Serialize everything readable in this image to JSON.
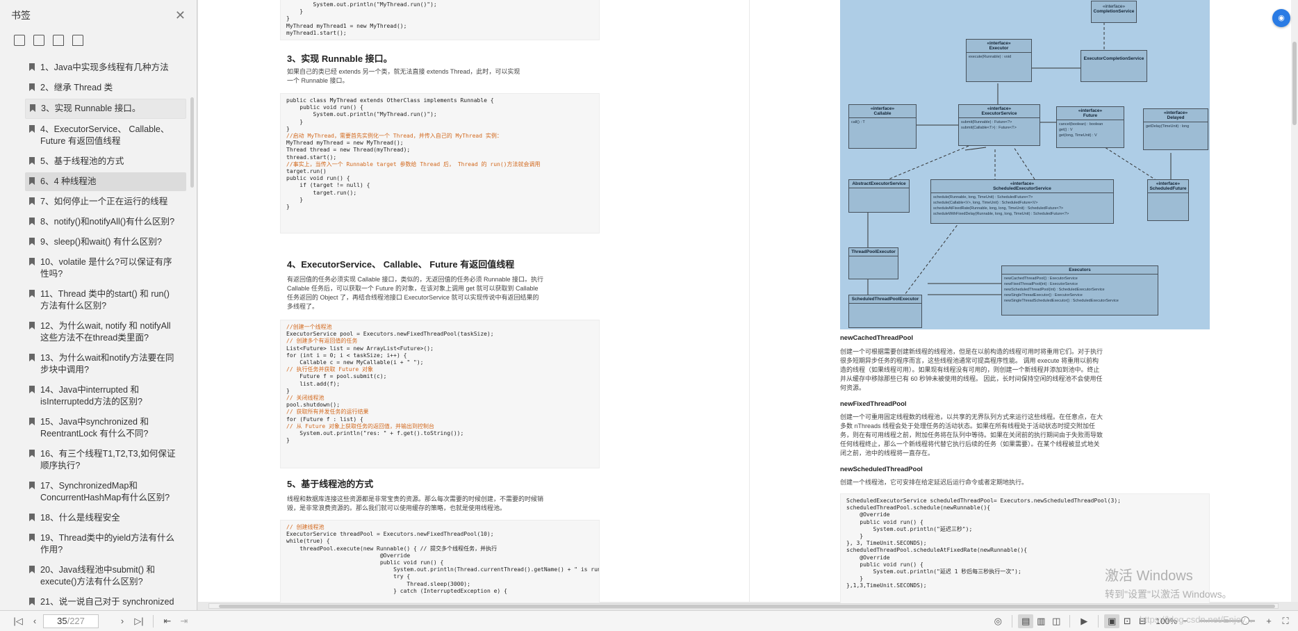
{
  "sidebar": {
    "title": "书签",
    "items": [
      {
        "label": "1、Java中实现多线程有几种方法"
      },
      {
        "label": "2、继承 Thread 类"
      },
      {
        "label": "3、实现 Runnable 接口。"
      },
      {
        "label": "4、ExecutorService、 Callable、 Future 有返回值线程"
      },
      {
        "label": "5、基于线程池的方式"
      },
      {
        "label": "6、4 种线程池"
      },
      {
        "label": "7、如何停止一个正在运行的线程"
      },
      {
        "label": "8、notify()和notifyAll()有什么区别?"
      },
      {
        "label": "9、sleep()和wait() 有什么区别?"
      },
      {
        "label": "10、volatile 是什么?可以保证有序性吗?"
      },
      {
        "label": "11、Thread 类中的start() 和 run() 方法有什么区别?"
      },
      {
        "label": "12、为什么wait, notify 和 notifyAll这些方法不在thread类里面?"
      },
      {
        "label": "13、为什么wait和notify方法要在同步块中调用?"
      },
      {
        "label": "14、Java中interrupted 和 isInterruptedd方法的区别?"
      },
      {
        "label": "15、Java中synchronized 和 ReentrantLock 有什么不同?"
      },
      {
        "label": "16、有三个线程T1,T2,T3,如何保证顺序执行?"
      },
      {
        "label": "17、SynchronizedMap和ConcurrentHashMap有什么区别?"
      },
      {
        "label": "18、什么是线程安全"
      },
      {
        "label": "19、Thread类中的yield方法有什么作用?"
      },
      {
        "label": "20、Java线程池中submit() 和 execute()方法有什么区别?"
      },
      {
        "label": "21、说一说自己对于 synchronized"
      }
    ]
  },
  "page1": {
    "code0": [
      "        System.out.println(\"MyThread.run()\");",
      "    }",
      "}",
      "MyThread myThread1 = new MyThread();",
      "myThread1.start();"
    ],
    "h3": "3、实现 Runnable 接口。",
    "p3": "如果自己的类已经 extends 另一个类，就无法直接 extends Thread，此时，可以实现一个 Runnable 接口。",
    "code3": [
      "public class MyThread extends OtherClass implements Runnable {",
      "    public void run() {",
      "        System.out.println(\"MyThread.run()\");",
      "    }",
      "}",
      "//启动 MyThread，需要首先实例化一个 Thread，并传入自己的 MyThread 实例：",
      "MyThread myThread = new MyThread();",
      "Thread thread = new Thread(myThread);",
      "thread.start();",
      "//事实上，当传入一个 Runnable target 参数给 Thread 后， Thread 的 run()方法就会调用",
      "target.run()",
      "public void run() {",
      "    if (target != null) {",
      "        target.run();",
      "    }",
      "}"
    ],
    "h4": "4、ExecutorService、 Callable、 Future 有返回值线程",
    "p4": "有返回值的任务必须实现 Callable 接口，类似的，无返回值的任务必须 Runnable 接口。执行 Callable 任务后，可以获取一个 Future 的对象，在该对象上调用 get 就可以获取到 Callable 任务返回的 Object 了，再结合线程池接口 ExecutorService 就可以实现传说中有返回结果的多线程了。",
    "code4": [
      "//创建一个线程池",
      "ExecutorService pool = Executors.newFixedThreadPool(taskSize);",
      "// 创建多个有返回值的任务",
      "List<Future> list = new ArrayList<Future>();",
      "for (int i = 0; i < taskSize; i++) {",
      "    Callable c = new MyCallable(i + \" \");",
      "// 执行任务并获取 Future 对象",
      "    Future f = pool.submit(c);",
      "    list.add(f);",
      "}",
      "// 关闭线程池",
      "pool.shutdown();",
      "// 获取所有并发任务的运行结果",
      "for (Future f : list) {",
      "// 从 Future 对象上获取任务的返回值，并输出到控制台",
      "    System.out.println(\"res: \" + f.get().toString());",
      "}"
    ],
    "h5": "5、基于线程池的方式",
    "p5": "线程和数据库连接这些资源都是非常宝贵的资源。那么每次需要的时候创建，不需要的时候销毁，是非常浪费资源的。那么我们就可以使用缓存的策略，也就是使用线程池。",
    "code5": [
      "// 创建线程池",
      "ExecutorService threadPool = Executors.newFixedThreadPool(10);",
      "while(true) {",
      "    threadPool.execute(new Runnable() { // 提交多个线程任务，并执行",
      "                            @Override",
      "                            public void run() {",
      "                                System.out.println(Thread.currentThread().getName() + \" is running ..\");",
      "                                try {",
      "                                    Thread.sleep(3000);",
      "                                } catch (InterruptedException e) {"
    ]
  },
  "page2": {
    "diagram": {
      "completion_service": {
        "stereo": "«interface»",
        "name": "CompletionService"
      },
      "executor": {
        "stereo": "«interface»",
        "name": "Executor",
        "methods": [
          "execute(Runnable) : void"
        ]
      },
      "ecs": {
        "name": "ExecutorCompletionService"
      },
      "callable": {
        "stereo": "«interface»",
        "name": "Callable",
        "methods": [
          "call() : T"
        ]
      },
      "executor_service": {
        "stereo": "«interface»",
        "name": "ExecutorService",
        "methods": [
          "submit(Runnable) : Future<?>",
          "submit(Callable<T>) : Future<T>"
        ]
      },
      "future": {
        "stereo": "«interface»",
        "name": "Future",
        "methods": [
          "cancel(boolean) : boolean",
          "get() : V",
          "get(long, TimeUnit) : V"
        ]
      },
      "delayed": {
        "stereo": "«interface»",
        "name": "Delayed",
        "methods": [
          "getDelay(TimeUnit) : long"
        ]
      },
      "abstract_es": {
        "name": "AbstractExecutorService"
      },
      "scheduled_es": {
        "stereo": "«interface»",
        "name": "ScheduledExecutorService",
        "methods": [
          "schedule(Runnable, long, TimeUnit) : ScheduledFuture<?>",
          "schedule(Callable<V>, long, TimeUnit) : ScheduledFuture<V>",
          "scheduleAtFixedRate(Runnable, long, long, TimeUnit) : ScheduledFuture<?>",
          "scheduleWithFixedDelay(Runnable, long, long, TimeUnit) : ScheduledFuture<?>"
        ]
      },
      "scheduled_future": {
        "stereo": "«interface»",
        "name": "ScheduledFuture"
      },
      "tpe": {
        "name": "ThreadPoolExecutor"
      },
      "executors": {
        "name": "Executors",
        "methods": [
          "newCachedThreadPool() : ExecutorService",
          "newFixedThreadPool(int) : ExecutorService",
          "newScheduledThreadPool(int) : ScheduledExecutorService",
          "newSingleThreadExecutor() : ExecutorService",
          "newSingleThreadScheduledExecutor() : ScheduledExecutorService"
        ]
      },
      "stpe": {
        "name": "ScheduledThreadPoolExecutor"
      }
    },
    "h_cached": "newCachedThreadPool",
    "p_cached": "创建一个可根据需要创建新线程的线程池，但是在以前构造的线程可用时将重用它们。对于执行很多短期异步任务的程序而言，这些线程池通常可提高程序性能。 调用 execute 将重用以前构造的线程（如果线程可用）。如果现有线程没有可用的，则创建一个新线程并添加到池中。终止并从缓存中移除那些已有 60 秒钟未被使用的线程。 因此，长时间保持空闲的线程池不会使用任何资源。",
    "h_fixed": "newFixedThreadPool",
    "p_fixed": "创建一个可重用固定线程数的线程池，以共享的无界队列方式来运行这些线程。在任意点，在大多数 nThreads 线程会处于处理任务的活动状态。如果在所有线程处于活动状态时提交附加任务，则在有可用线程之前，附加任务将在队列中等待。如果在关闭前的执行期间由于失败而导致任何线程终止，那么一个新线程将代替它执行后续的任务（如果需要）。在某个线程被显式地关闭之前，池中的线程将一直存在。",
    "h_sched": "newScheduledThreadPool",
    "p_sched": "创建一个线程池，它可安排在给定延迟后运行命令或者定期地执行。",
    "code_sched": [
      "ScheduledExecutorService scheduledThreadPool= Executors.newScheduledThreadPool(3);",
      "scheduledThreadPool.schedule(newRunnable(){",
      "    @Override",
      "    public void run() {",
      "        System.out.println(\"延迟三秒\");",
      "    }",
      "}, 3, TimeUnit.SECONDS);",
      "scheduledThreadPool.scheduleAtFixedRate(newRunnable(){",
      "    @Override",
      "    public void run() {",
      "        System.out.println(\"延迟 1 秒后每三秒执行一次\");",
      "    }",
      "},1,3,TimeUnit.SECONDS);"
    ]
  },
  "overlay": {
    "activate_title": "激活 Windows",
    "activate_sub": "转到\"设置\"以激活 Windows。",
    "url_watermark": "https://blog.csdn.net/Enjoy..."
  },
  "statusbar": {
    "page_current": "35",
    "page_total": "/227",
    "zoom": "100%"
  }
}
